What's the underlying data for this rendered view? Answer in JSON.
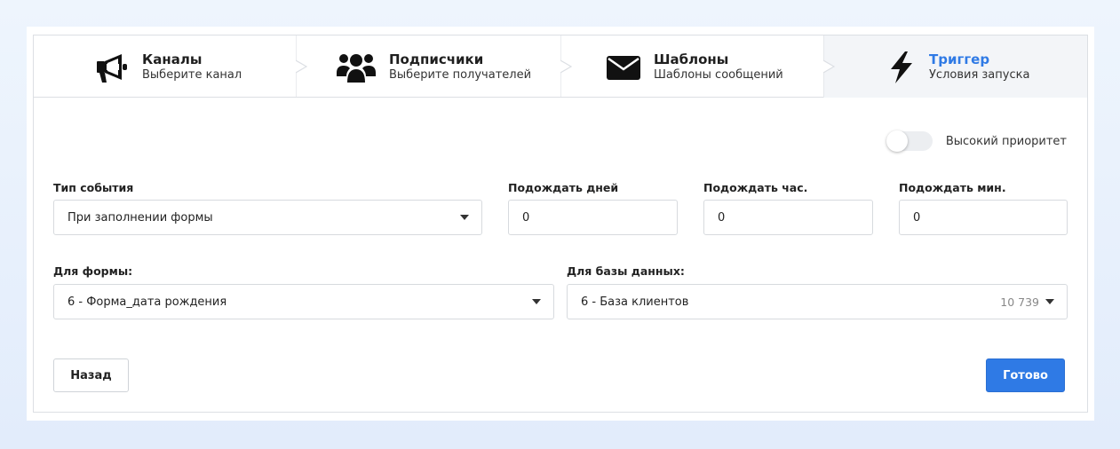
{
  "steps": [
    {
      "title": "Каналы",
      "subtitle": "Выберите канал",
      "icon": "megaphone-icon"
    },
    {
      "title": "Подписчики",
      "subtitle": "Выберите получателей",
      "icon": "users-icon"
    },
    {
      "title": "Шаблоны",
      "subtitle": "Шаблоны сообщений",
      "icon": "envelope-icon"
    },
    {
      "title": "Триггер",
      "subtitle": "Условия запуска",
      "icon": "lightning-icon",
      "active": true
    }
  ],
  "priority": {
    "label": "Высокий приоритет",
    "enabled": false
  },
  "event_type": {
    "label": "Тип события",
    "value": "При заполнении формы"
  },
  "wait_days": {
    "label": "Подождать дней",
    "value": "0"
  },
  "wait_hours": {
    "label": "Подождать час.",
    "value": "0"
  },
  "wait_minutes": {
    "label": "Подождать мин.",
    "value": "0"
  },
  "form": {
    "label": "Для формы:",
    "value": "6 - Форма_дата рождения"
  },
  "database": {
    "label": "Для базы данных:",
    "value": "6 - База клиентов",
    "count": "10 739"
  },
  "buttons": {
    "back": "Назад",
    "done": "Готово"
  },
  "colors": {
    "accent": "#2f7ae5",
    "border": "#dcdfe4",
    "active_step_bg": "#f3f5f8"
  }
}
